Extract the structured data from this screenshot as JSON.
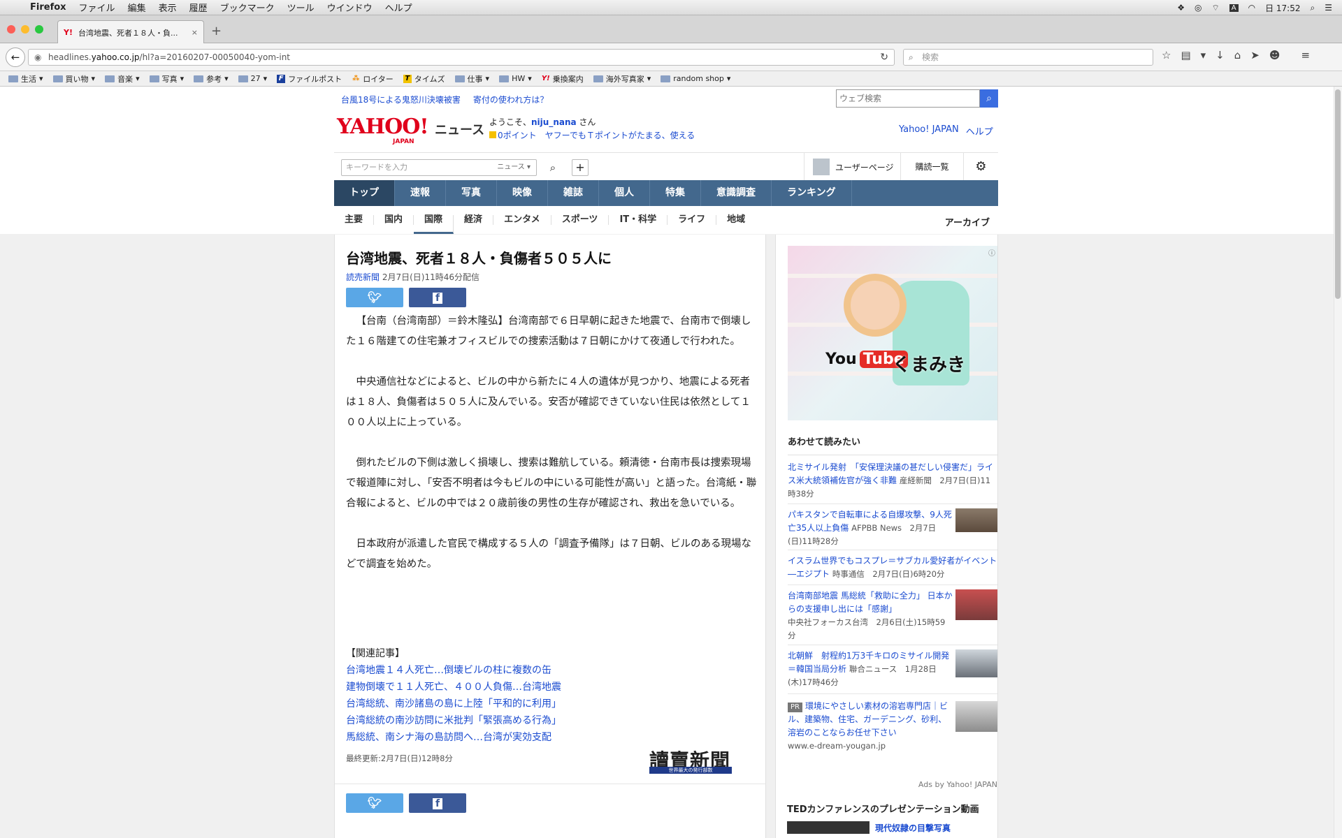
{
  "menubar": {
    "app": "Firefox",
    "items": [
      "ファイル",
      "編集",
      "表示",
      "履歴",
      "ブックマーク",
      "ツール",
      "ウインドウ",
      "ヘルプ"
    ],
    "clock": "日 17:52"
  },
  "tab": {
    "title": "台湾地震、死者１８人・負...",
    "favicon": "Y!"
  },
  "urlbar": {
    "prefix": "headlines.",
    "host": "yahoo.co.jp",
    "path": "/hl?a=20160207-00050040-yom-int"
  },
  "searchbar": {
    "placeholder": "検索"
  },
  "bookmarks": [
    {
      "label": "生活",
      "type": "folder"
    },
    {
      "label": "買い物",
      "type": "folder"
    },
    {
      "label": "音楽",
      "type": "folder"
    },
    {
      "label": "写真",
      "type": "folder"
    },
    {
      "label": "参考",
      "type": "folder"
    },
    {
      "label": "27",
      "type": "folder"
    },
    {
      "label": "ファイルポスト",
      "type": "link"
    },
    {
      "label": "ロイター",
      "type": "link"
    },
    {
      "label": "タイムズ",
      "type": "link"
    },
    {
      "label": "仕事",
      "type": "folder"
    },
    {
      "label": "HW",
      "type": "folder"
    },
    {
      "label": "乗換案内",
      "type": "link"
    },
    {
      "label": "海外写真家",
      "type": "folder"
    },
    {
      "label": "random shop",
      "type": "folder"
    }
  ],
  "page": {
    "alerts": [
      "台風18号による鬼怒川決壊被害",
      "寄付の使われ方は？"
    ],
    "websearch_placeholder": "ウェブ検索",
    "logo": {
      "main": "YAHOO!",
      "sub": "JAPAN",
      "section": "ニュース"
    },
    "welcome": {
      "prefix": "ようこそ、",
      "user": "niju_nana",
      "suffix": " さん",
      "points": "0ポイント",
      "promo": "ヤフーでもＴポイントがたまる、使える"
    },
    "toplinks": [
      "Yahoo! JAPAN",
      "ヘルプ"
    ],
    "keyword_placeholder": "キーワードを入力",
    "keyword_category": "ニュース",
    "userpage": "ユーザーページ",
    "subscriptions": "購読一覧",
    "mainnav": [
      "トップ",
      "速報",
      "写真",
      "映像",
      "雑誌",
      "個人",
      "特集",
      "意識調査",
      "ランキング"
    ],
    "subnav": [
      "主要",
      "国内",
      "国際",
      "経済",
      "エンタメ",
      "スポーツ",
      "IT・科学",
      "ライフ",
      "地域"
    ],
    "archive": "アーカイブ"
  },
  "article": {
    "title": "台湾地震、死者１８人・負傷者５０５人に",
    "source": "読売新聞",
    "date": "2月7日(日)11時46分配信",
    "paragraphs": [
      "【台南（台湾南部）＝鈴木隆弘】台湾南部で６日早朝に起きた地震で、台南市で倒壊した１６階建ての住宅兼オフィスビルでの捜索活動は７日朝にかけて夜通しで行われた。",
      "中央通信社などによると、ビルの中から新たに４人の遺体が見つかり、地震による死者は１８人、負傷者は５０５人に及んでいる。安否が確認できていない住民は依然として１００人以上に上っている。",
      "倒れたビルの下側は激しく損壊し、捜索は難航している。頼清徳・台南市長は捜索現場で報道陣に対し、「安否不明者は今もビルの中にいる可能性が高い」と語った。台湾紙・聯合報によると、ビルの中では２０歳前後の男性の生存が確認され、救出を急いでいる。",
      "日本政府が派遣した官民で構成する５人の「調査予備隊」は７日朝、ビルのある現場などで調査を始めた。"
    ],
    "related_heading": "【関連記事】",
    "related": [
      "台湾地震１４人死亡…倒壊ビルの柱に複数の缶",
      "建物倒壊で１１人死亡、４００人負傷…台湾地震",
      "台湾総統、南沙諸島の島に上陸「平和的に利用」",
      "台湾総統の南沙訪問に米批判「緊張高める行為」",
      "馬総統、南シナ海の島訪問へ…台湾が実効支配"
    ],
    "updated": "最終更新:2月7日(日)12時8分",
    "publisher_logo": "讀賣新聞",
    "publisher_tagline": "世界最大の発行部数"
  },
  "sidebar": {
    "ad": {
      "youtube_you": "You",
      "youtube_tube": "Tube",
      "name": "くまみき"
    },
    "alsoread_title": "あわせて読みたい",
    "items": [
      {
        "title": "北ミサイル発射　「安保理決議の甚だしい侵害だ」ライス米大統領補佐官が強く非難",
        "source": "産経新聞　2月7日(日)11時38分",
        "thumb": false
      },
      {
        "title": "パキスタンで自転車による自爆攻撃、9人死亡35人以上負傷",
        "source": "AFPBB News　2月7日(日)11時28分",
        "thumb": true
      },
      {
        "title": "イスラム世界でもコスプレ＝サブカル愛好者がイベント―エジプト",
        "source": "時事通信　2月7日(日)6時20分",
        "thumb": false
      },
      {
        "title": "台湾南部地震 馬総統「救助に全力」 日本からの支援申し出には「感謝」",
        "source": "中央社フォーカス台湾　2月6日(土)15時59分",
        "thumb": true
      },
      {
        "title": "北朝鮮　射程約1万3千キロのミサイル開発＝韓国当局分析",
        "source": "聯合ニュース　1月28日(木)17時46分",
        "thumb": true
      }
    ],
    "pr": {
      "badge": "PR",
      "title": "環境にやさしい素材の溶岩専門店｜ビル、建築物、住宅、ガーデニング、砂利、溶岩のことならお任せ下さい",
      "url": "www.e-dream-yougan.jp"
    },
    "ads_by": "Ads by Yahoo! JAPAN",
    "ted_title": "TEDカンファレンスのプレゼンテーション動画",
    "ted_item": "現代奴隷の目撃写真"
  }
}
